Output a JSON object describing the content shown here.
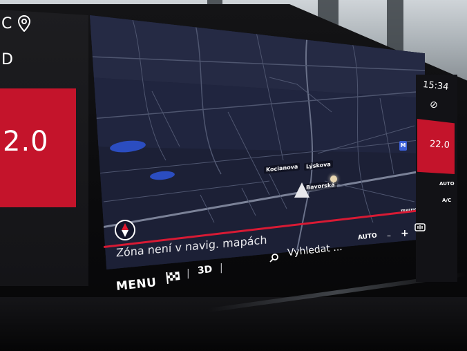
{
  "left_panel": {
    "top_letter": "C",
    "mid_glyph": "D",
    "temperature": "2.0",
    "pin_icon": "location-pin-icon"
  },
  "map": {
    "labels": [
      {
        "text": "Kocianova"
      },
      {
        "text": "Lýskova"
      },
      {
        "text": "Bavorská"
      }
    ],
    "zone_message": "Zóna není v navig. mapách",
    "traffic_badge": "TRAFFIC",
    "map_badge": "M",
    "colors": {
      "background": "#1c2036",
      "roads": "#5a6179",
      "water": "#2b4dc0",
      "accent": "#d81a34"
    }
  },
  "right_panel": {
    "clock": "15:34",
    "glyph": "⊘",
    "temperature": "22.0",
    "auto_label": "AUTO",
    "ac_label": "A/C"
  },
  "bottom_bar": {
    "menu_label": "MENU",
    "flag_icon": "checkered-flag-icon",
    "mode_3d_label": "3D",
    "search_label": "Vyhledat ...",
    "volume_auto_label": "AUTO",
    "volume_minus": "–",
    "volume_plus": "+",
    "separator": "|"
  }
}
